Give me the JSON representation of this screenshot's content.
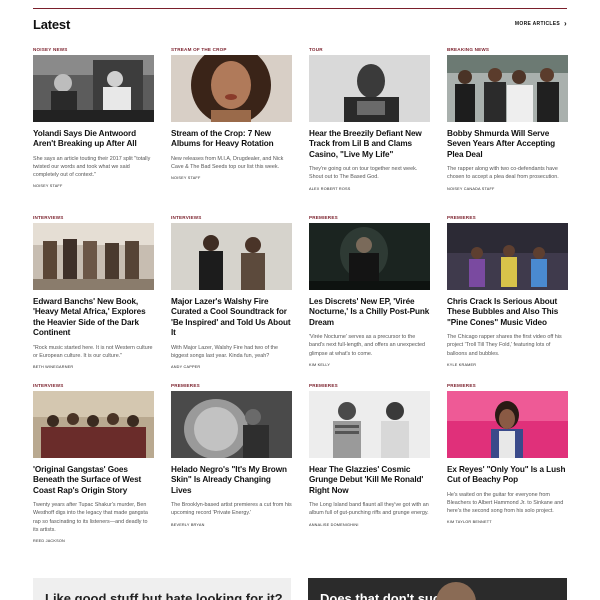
{
  "section": {
    "title": "Latest",
    "more_label": "MORE ARTICLES",
    "more_icon": "chevron-right-icon"
  },
  "colors": {
    "accent": "#7a1f2b",
    "text": "#111111",
    "muted": "#555555"
  },
  "articles": [
    {
      "category": "NOISEY NEWS",
      "title": "Yolandi Says Die Antwoord Aren't Breaking up After All",
      "description": "She says an article touting their 2017 split \"totally twisted our words and took what we said completely out of context.\"",
      "author": "NOISEY STAFF"
    },
    {
      "category": "STREAM OF THE CROP",
      "title": "Stream of the Crop: 7 New Albums for Heavy Rotation",
      "description": "New releases from M.I.A, Drugdealer, and Nick Cave & The Bad Seeds top our list this week.",
      "author": "NOISEY STAFF"
    },
    {
      "category": "TOUR",
      "title": "Hear the Breezily Defiant New Track from Lil B and Clams Casino, \"Live My Life\"",
      "description": "They're going out on tour together next week. Shout out to The Based God.",
      "author": "ALEX ROBERT ROSS"
    },
    {
      "category": "BREAKING NEWS",
      "title": "Bobby Shmurda Will Serve Seven Years After Accepting Plea Deal",
      "description": "The rapper along with two co-defendants have chosen to accept a plea deal from prosecution.",
      "author": "NOISEY CANADA STAFF"
    },
    {
      "category": "INTERVIEWS",
      "title": "Edward Banchs' New Book, 'Heavy Metal Africa,' Explores the Heavier Side of the Dark Continent",
      "description": "\"Rock music started here. It is not Western culture or European culture. It is our culture.\"",
      "author": "BETH WINEGARNER"
    },
    {
      "category": "INTERVIEWS",
      "title": "Major Lazer's Walshy Fire Curated a Cool Soundtrack for 'Be Inspired' and Told Us About It",
      "description": "With Major Lazer, Walshy Fire had two of the biggest songs last year. Kinda fun, yeah?",
      "author": "ANDY CAPPER"
    },
    {
      "category": "PREMIERES",
      "title": "Les Discrets' New EP, 'Virée Nocturne,' Is a Chilly Post-Punk Dream",
      "description": "'Virée Nocturne' serves as a precursor to the band's next full-length, and offers an unexpected glimpse at what's to come.",
      "author": "KIM KELLY"
    },
    {
      "category": "PREMIERES",
      "title": "Chris Crack Is Serious About These Bubbles and Also This \"Pine Cones\" Music Video",
      "description": "The Chicago rapper shares the first video off his project 'Troll Till They Fold,' featuring lots of balloons and bubbles.",
      "author": "KYLE KRAMER"
    },
    {
      "category": "INTERVIEWS",
      "title": "'Original Gangstas' Goes Beneath the Surface of West Coast Rap's Origin Story",
      "description": "Twenty years after Tupac Shakur's murder, Ben Westhoff digs into the legacy that made gangsta rap so fascinating to its listeners—and deadly to its artists.",
      "author": "REED JACKSON"
    },
    {
      "category": "PREMIERES",
      "title": "Helado Negro's \"It's My Brown Skin\" Is Already Changing Lives",
      "description": "The Brooklyn-based artist premieres a cut from his upcoming record 'Private Energy.'",
      "author": "BEVERLY BRYAN"
    },
    {
      "category": "PREMIERES",
      "title": "Hear The Glazzies' Cosmic Grunge Debut 'Kill Me Ronald' Right Now",
      "description": "The Long Island band flaunt all they've got with an album full of gut-punching riffs and grunge energy.",
      "author": "ANNALISE DOMENIGHINI"
    },
    {
      "category": "PREMIERES",
      "title": "Ex Reyes' \"Only You\" Is a Lush Cut of Beachy Pop",
      "description": "He's waited on the guitar for everyone from Bleachers to Albert Hammond Jr. to Sinkane and here's the second song from his solo project.",
      "author": "KIM TAYLOR BENNETT"
    }
  ],
  "promos": {
    "left": "Like good stuff but hate looking for it?",
    "right": "Does that don't suck"
  }
}
